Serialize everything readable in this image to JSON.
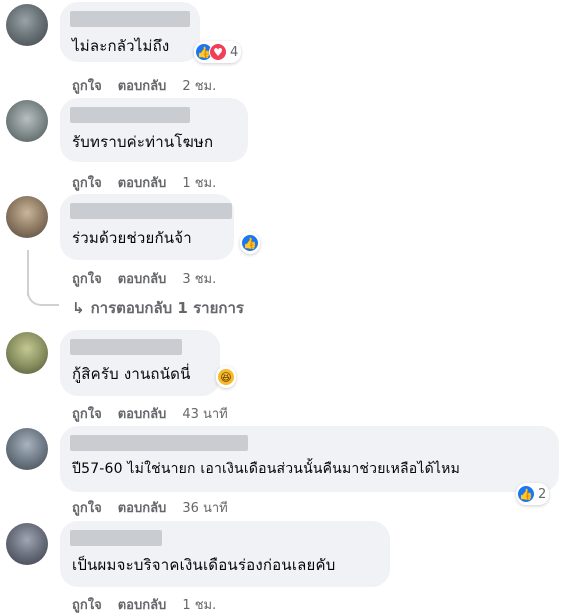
{
  "comments": [
    {
      "text": "ไม่ละกลัวไม่ถึง",
      "like": "ถูกใจ",
      "reply": "ตอบกลับ",
      "time": "2 ชม.",
      "reaction_count": "4",
      "reactions": [
        "like-icon",
        "love-icon"
      ]
    },
    {
      "text": "รับทราบค่ะท่านโฆษก",
      "like": "ถูกใจ",
      "reply": "ตอบกลับ",
      "time": "1 ชม."
    },
    {
      "text": "ร่วมด้วยช่วยกันจ้า",
      "like": "ถูกใจ",
      "reply": "ตอบกลับ",
      "time": "3 ชม.",
      "reactions": [
        "like-icon"
      ]
    },
    {
      "text": "กู้สิครับ งานถนัดนี่",
      "like": "ถูกใจ",
      "reply": "ตอบกลับ",
      "time": "43 นาที",
      "reactions": [
        "haha-icon"
      ]
    },
    {
      "text": "ปี57-60 ไม่ใช่นายก เอาเงินเดือนส่วนนั้นคืนมาช่วยเหลือได้ไหม",
      "like": "ถูกใจ",
      "reply": "ตอบกลับ",
      "time": "36 นาที",
      "reaction_count": "2",
      "reactions": [
        "like-icon"
      ]
    },
    {
      "text": "เป็นผมจะบริจาคเงินเดือนร่องก่อนเลยคับ",
      "like": "ถูกใจ",
      "reply": "ตอบกลับ",
      "time": "1 ชม."
    }
  ],
  "replies_link": {
    "arrow": "↳",
    "label": "การตอบกลับ 1 รายการ"
  },
  "colors": {
    "bubble": "#f0f2f5",
    "like_blue": "#1877f2",
    "love_red": "#f33e58",
    "muted": "#65676b"
  }
}
